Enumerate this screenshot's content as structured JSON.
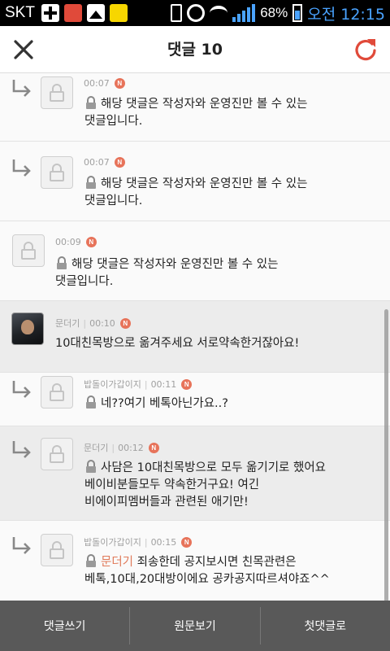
{
  "status_bar": {
    "carrier": "SKT",
    "battery": "68%",
    "time": "오전 12:15",
    "icons": [
      "plus-icon",
      "app-red-icon",
      "image-icon",
      "talk-icon",
      "vibrate-icon",
      "alarm-icon",
      "wifi-icon",
      "signal-icon",
      "battery-icon"
    ],
    "accent": "#4aa3ff"
  },
  "header": {
    "title": "댓글 10",
    "close_icon": "close-icon",
    "refresh_icon": "refresh-icon",
    "refresh_color": "#e04a3a"
  },
  "comments": [
    {
      "reply": true,
      "author": "",
      "time": "00:07",
      "badge": "N",
      "locked": true,
      "lines": [
        "해당 댓글은 작성자와 운영진만 볼 수 있는",
        "댓글입니다."
      ]
    },
    {
      "reply": true,
      "author": "",
      "time": "00:07",
      "badge": "N",
      "locked": true,
      "lines": [
        "해당 댓글은 작성자와 운영진만 볼 수 있는",
        "댓글입니다."
      ]
    },
    {
      "reply": false,
      "author": "",
      "time": "00:09",
      "badge": "N",
      "locked": true,
      "lines": [
        "해당 댓글은 작성자와 운영진만 볼 수 있는",
        "댓글입니다."
      ]
    },
    {
      "reply": false,
      "author": "문더기",
      "time": "00:10",
      "badge": "N",
      "locked": false,
      "lines": [
        "10대친목방으로 옮겨주세요 서로약속한거잖아요!"
      ]
    },
    {
      "reply": true,
      "author": "밥돌이가갑이지",
      "time": "00:11",
      "badge": "N",
      "locked": true,
      "lines": [
        "네??여기 베톡아닌가요..?"
      ]
    },
    {
      "reply": true,
      "author": "문더기",
      "time": "00:12",
      "badge": "N",
      "locked": true,
      "lines": [
        "사담은 10대친목방으로 모두 옮기기로 했어요",
        "베이비분들모두 약속한거구요! 여긴",
        "비에이피멤버들과 관련된 애기만!"
      ]
    },
    {
      "reply": true,
      "author": "밥돌이가갑이지",
      "time": "00:15",
      "badge": "N",
      "locked": true,
      "mention": "문더기",
      "lines": [
        "죄송한데 공지보시면 친목관련은",
        "베톡,10대,20대방이에요 공카공지따르셔야죠^^"
      ]
    }
  ],
  "bottom_bar": {
    "write": "댓글쓰기",
    "original": "원문보기",
    "first": "첫댓글로"
  }
}
